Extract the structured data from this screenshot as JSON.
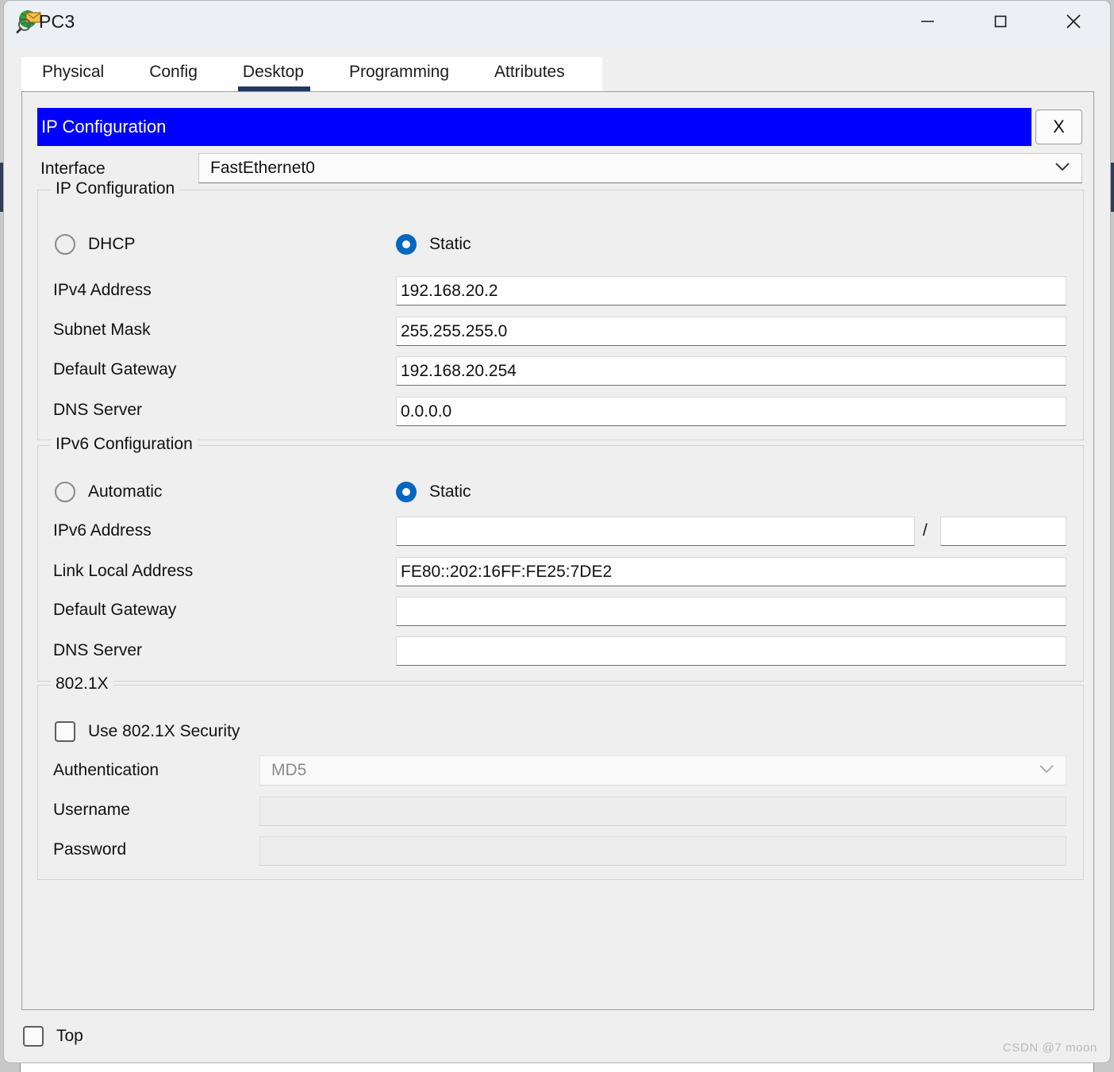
{
  "window": {
    "title": "PC3",
    "icon": "packet-tracer-icon",
    "controls": {
      "minimize": "minimize-icon",
      "maximize": "maximize-icon",
      "close": "close-icon"
    }
  },
  "tabs": [
    {
      "label": "Physical",
      "active": false
    },
    {
      "label": "Config",
      "active": false
    },
    {
      "label": "Desktop",
      "active": true
    },
    {
      "label": "Programming",
      "active": false
    },
    {
      "label": "Attributes",
      "active": false
    }
  ],
  "app": {
    "header_title": "IP Configuration",
    "close_label": "X",
    "header_color": "#0000ff"
  },
  "interface": {
    "label": "Interface",
    "value": "FastEthernet0"
  },
  "ipv4": {
    "group_title": "IP Configuration",
    "mode": {
      "dhcp_label": "DHCP",
      "dhcp_selected": false,
      "static_label": "Static",
      "static_selected": true
    },
    "fields": [
      {
        "label": "IPv4 Address",
        "value": "192.168.20.2"
      },
      {
        "label": "Subnet Mask",
        "value": "255.255.255.0"
      },
      {
        "label": "Default Gateway",
        "value": "192.168.20.254"
      },
      {
        "label": "DNS Server",
        "value": "0.0.0.0"
      }
    ]
  },
  "ipv6": {
    "group_title": "IPv6 Configuration",
    "mode": {
      "automatic_label": "Automatic",
      "automatic_selected": false,
      "static_label": "Static",
      "static_selected": true
    },
    "address_label": "IPv6 Address",
    "address_value": "",
    "prefix_separator": "/",
    "prefix_value": "",
    "fields": [
      {
        "label": "Link Local Address",
        "value": "FE80::202:16FF:FE25:7DE2"
      },
      {
        "label": "Default Gateway",
        "value": ""
      },
      {
        "label": "DNS Server",
        "value": ""
      }
    ]
  },
  "dot1x": {
    "group_title": "802.1X",
    "use_security_label": "Use 802.1X Security",
    "use_security_checked": false,
    "authentication_label": "Authentication",
    "authentication_value": "MD5",
    "username_label": "Username",
    "username_value": "",
    "password_label": "Password",
    "password_value": ""
  },
  "footer": {
    "top_label": "Top",
    "top_checked": false
  },
  "watermark": "CSDN @7 moon"
}
